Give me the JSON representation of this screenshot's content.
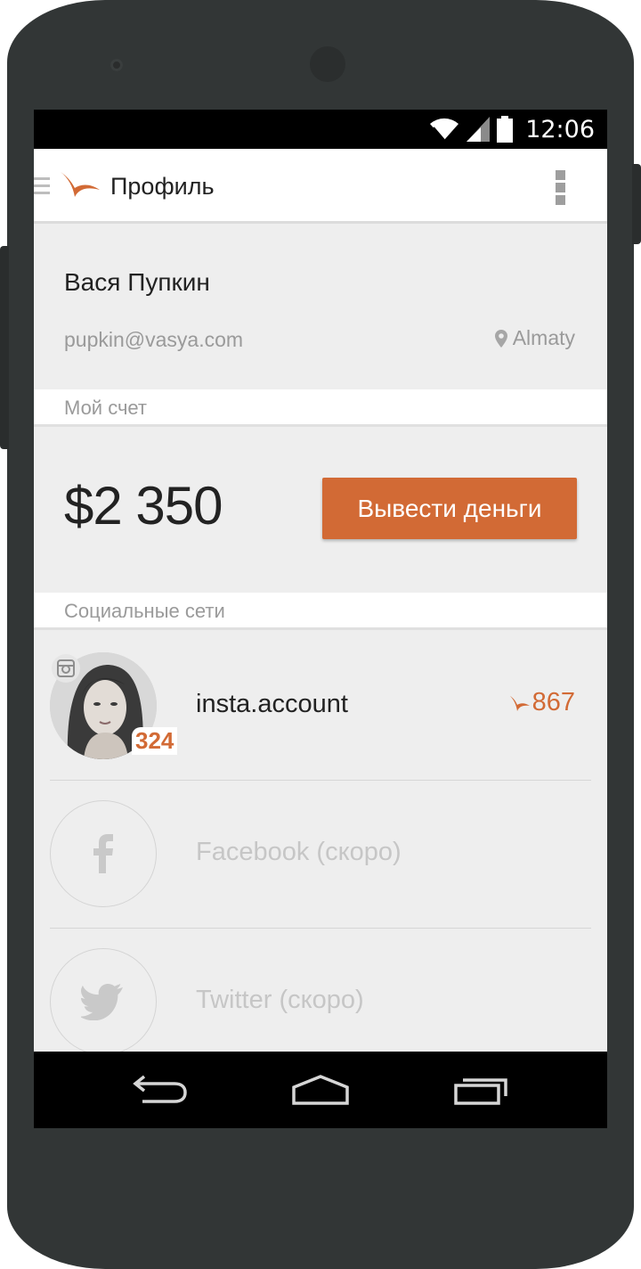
{
  "status_bar": {
    "time": "12:06",
    "icons": [
      "wifi-icon",
      "signal-icon",
      "battery-icon"
    ]
  },
  "app_bar": {
    "title": "Профиль",
    "icons": [
      "menu-icon",
      "app-logo-bird-icon",
      "overflow-menu-icon"
    ]
  },
  "profile": {
    "name": "Вася Пупкин",
    "email": "pupkin@vasya.com",
    "city": "Almaty",
    "city_icon": "location-pin-icon"
  },
  "account_section": {
    "header": "Мой счет",
    "balance": "$2 350",
    "withdraw_label": "Вывести деньги"
  },
  "social_section": {
    "header": "Социальные сети",
    "accounts": [
      {
        "name": "insta.account",
        "followers": "324",
        "score": "867",
        "icon": "instagram-icon"
      },
      {
        "label": "Facebook (скоро)",
        "icon": "facebook-icon"
      },
      {
        "label": "Twitter (скоро)",
        "icon": "twitter-icon"
      }
    ]
  },
  "nav_bar": {
    "icons": [
      "back-icon",
      "home-icon",
      "recents-icon"
    ]
  },
  "colors": {
    "accent": "#d26a35",
    "device": "#323636",
    "screen_bg": "#eeeeee"
  }
}
